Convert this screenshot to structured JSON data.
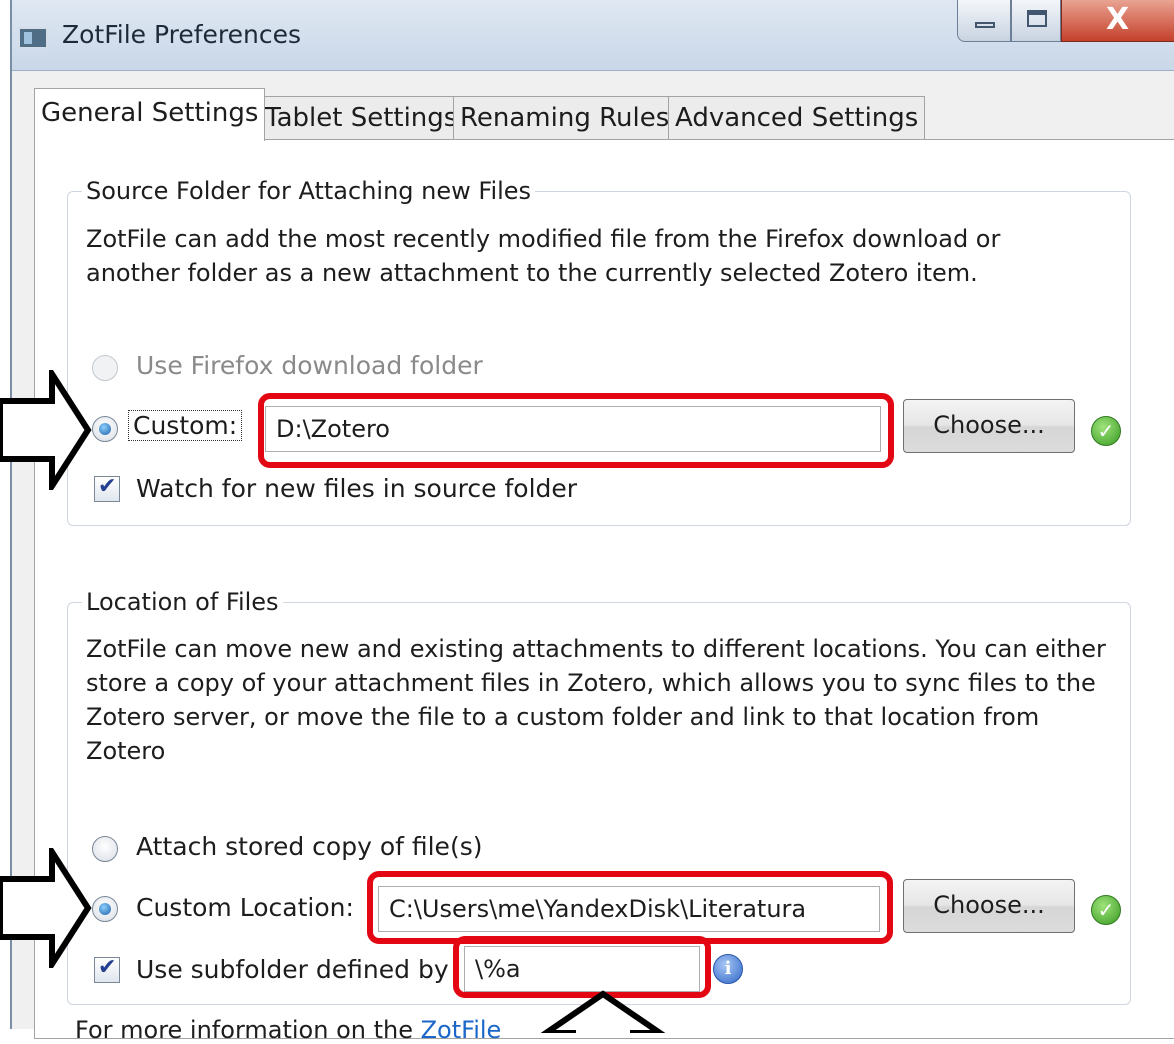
{
  "window": {
    "title": "ZotFile Preferences"
  },
  "tabs": [
    {
      "label": "General Settings",
      "active": true
    },
    {
      "label": "Tablet Settings",
      "active": false
    },
    {
      "label": "Renaming Rules",
      "active": false
    },
    {
      "label": "Advanced Settings",
      "active": false
    }
  ],
  "source_folder": {
    "legend": "Source Folder for Attaching new Files",
    "description": "ZotFile can add the most recently modified file from the Firefox download or another folder as a new attachment to the currently selected Zotero item.",
    "option_firefox_label": "Use Firefox download folder",
    "option_custom_label": "Custom:",
    "custom_path": "D:\\Zotero",
    "choose_label": "Choose...",
    "watch_label": "Watch for new files in source folder"
  },
  "location": {
    "legend": "Location of Files",
    "description": "ZotFile can move new and existing attachments to different locations. You can either store a copy of your attachment files in Zotero, which allows you to sync files to the Zotero server, or move the file to a custom folder and link to that location from Zotero",
    "option_stored_label": "Attach stored copy of file(s)",
    "option_custom_label": "Custom Location:",
    "custom_path": "C:\\Users\\me\\YandexDisk\\Literatura",
    "choose_label": "Choose...",
    "subfolder_label": "Use subfolder defined by",
    "subfolder_value": "\\%a"
  },
  "footer": {
    "text": "For more information on the ",
    "link": "ZotFile"
  },
  "colors": {
    "highlight": "#e30613",
    "link": "#1a66c9"
  },
  "icons": {
    "app": "zotfile-icon",
    "ok": "checkmark-ok-icon",
    "info": "info-icon",
    "annotation_arrow": "arrow-icon"
  }
}
